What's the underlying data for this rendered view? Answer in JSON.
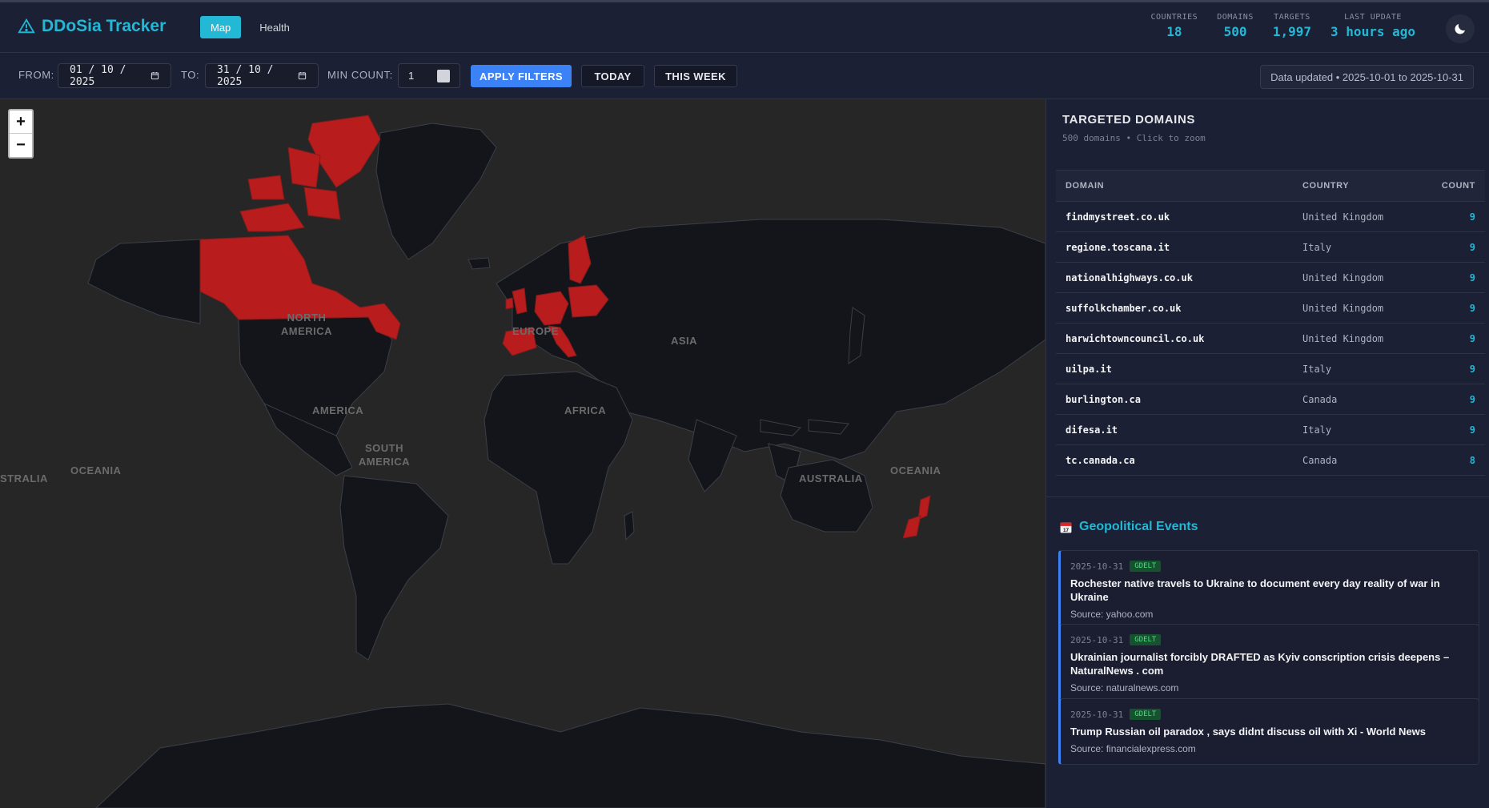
{
  "app": {
    "title": "DDoSia Tracker"
  },
  "nav": {
    "tabs": [
      {
        "label": "Map"
      },
      {
        "label": "Health"
      }
    ]
  },
  "stats": [
    {
      "label": "COUNTRIES",
      "value": "18"
    },
    {
      "label": "DOMAINS",
      "value": "500"
    },
    {
      "label": "TARGETS",
      "value": "1,997"
    },
    {
      "label": "LAST UPDATE",
      "value": "3 hours ago"
    }
  ],
  "filters": {
    "from_label": "FROM:",
    "from_value": "01 / 10 / 2025",
    "to_label": "TO:",
    "to_value": "31 / 10 / 2025",
    "min_count_label": "MIN COUNT:",
    "min_count_value": "1",
    "apply_label": "APPLY FILTERS",
    "today_label": "TODAY",
    "week_label": "THIS WEEK",
    "updated_text": "Data updated • 2025-10-01 to 2025-10-31"
  },
  "map": {
    "zoom_in": "+",
    "zoom_out": "−",
    "highlight_color": "#b91c1c",
    "labels": {
      "north_america": "NORTH AMERICA",
      "europe": "EUROPE",
      "asia": "ASIA",
      "america": "AMERICA",
      "africa": "AFRICA",
      "south_america": "SOUTH AMERICA",
      "oceania_left": "OCEANIA",
      "australia_left": "STRALIA",
      "australia": "AUSTRALIA",
      "oceania_right": "OCEANIA"
    }
  },
  "domains_panel": {
    "title": "TARGETED DOMAINS",
    "subtitle": "500 domains • Click to zoom",
    "headers": {
      "domain": "DOMAIN",
      "country": "COUNTRY",
      "count": "COUNT"
    },
    "rows": [
      {
        "domain": "findmystreet.co.uk",
        "country": "United Kingdom",
        "count": "9"
      },
      {
        "domain": "regione.toscana.it",
        "country": "Italy",
        "count": "9"
      },
      {
        "domain": "nationalhighways.co.uk",
        "country": "United Kingdom",
        "count": "9"
      },
      {
        "domain": "suffolkchamber.co.uk",
        "country": "United Kingdom",
        "count": "9"
      },
      {
        "domain": "harwichtowncouncil.co.uk",
        "country": "United Kingdom",
        "count": "9"
      },
      {
        "domain": "uilpa.it",
        "country": "Italy",
        "count": "9"
      },
      {
        "domain": "burlington.ca",
        "country": "Canada",
        "count": "9"
      },
      {
        "domain": "difesa.it",
        "country": "Italy",
        "count": "9"
      },
      {
        "domain": "tc.canada.ca",
        "country": "Canada",
        "count": "8"
      }
    ]
  },
  "events": {
    "title": "Geopolitical Events",
    "items": [
      {
        "date": "2025-10-31",
        "badge": "GDELT",
        "title": "Rochester native travels to Ukraine to document every day reality of war in Ukraine",
        "source": "Source: yahoo.com"
      },
      {
        "date": "2025-10-31",
        "badge": "GDELT",
        "title": "Ukrainian journalist forcibly DRAFTED as Kyiv conscription crisis deepens – NaturalNews . com",
        "source": "Source: naturalnews.com"
      },
      {
        "date": "2025-10-31",
        "badge": "GDELT",
        "title": "Trump Russian oil paradox , says didnt discuss oil with Xi - World News",
        "source": "Source: financialexpress.com"
      }
    ]
  }
}
